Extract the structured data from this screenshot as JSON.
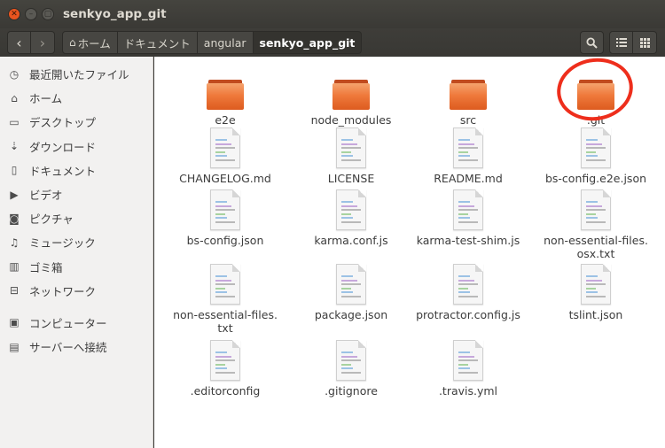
{
  "window": {
    "title": "senkyo_app_git"
  },
  "toolbar": {
    "breadcrumbs": [
      "ホーム",
      "ドキュメント",
      "angular",
      "senkyo_app_git"
    ]
  },
  "sidebar": {
    "items": [
      {
        "label": "最近開いたファイル",
        "icon": "clock-icon"
      },
      {
        "label": "ホーム",
        "icon": "home-icon"
      },
      {
        "label": "デスクトップ",
        "icon": "desktop-icon"
      },
      {
        "label": "ダウンロード",
        "icon": "download-icon"
      },
      {
        "label": "ドキュメント",
        "icon": "document-icon"
      },
      {
        "label": "ビデオ",
        "icon": "video-icon"
      },
      {
        "label": "ピクチャ",
        "icon": "camera-icon"
      },
      {
        "label": "ミュージック",
        "icon": "music-icon"
      },
      {
        "label": "ゴミ箱",
        "icon": "trash-icon"
      },
      {
        "label": "ネットワーク",
        "icon": "network-icon"
      },
      {
        "label": "コンピューター",
        "icon": "computer-icon"
      },
      {
        "label": "サーバーへ接続",
        "icon": "server-icon"
      }
    ]
  },
  "files": [
    {
      "name": "e2e",
      "kind": "folder"
    },
    {
      "name": "node_modules",
      "kind": "folder"
    },
    {
      "name": "src",
      "kind": "folder"
    },
    {
      "name": ".git",
      "kind": "folder"
    },
    {
      "name": "CHANGELOG.md",
      "kind": "file"
    },
    {
      "name": "LICENSE",
      "kind": "file"
    },
    {
      "name": "README.md",
      "kind": "file"
    },
    {
      "name": "bs-config.e2e.json",
      "kind": "file"
    },
    {
      "name": "bs-config.json",
      "kind": "file"
    },
    {
      "name": "karma.conf.js",
      "kind": "file"
    },
    {
      "name": "karma-test-shim.js",
      "kind": "file"
    },
    {
      "name": "non-essential-files.\nosx.txt",
      "kind": "file"
    },
    {
      "name": "non-essential-files.\ntxt",
      "kind": "file"
    },
    {
      "name": "package.json",
      "kind": "file"
    },
    {
      "name": "protractor.config.js",
      "kind": "file"
    },
    {
      "name": "tslint.json",
      "kind": "file"
    },
    {
      "name": ".editorconfig",
      "kind": "file"
    },
    {
      "name": ".gitignore",
      "kind": "file"
    },
    {
      "name": ".travis.yml",
      "kind": "file"
    }
  ],
  "colors": {
    "annotation": "#ee2e1c",
    "folder": "#ef7a3c",
    "titlebar": "#3c3b37"
  }
}
